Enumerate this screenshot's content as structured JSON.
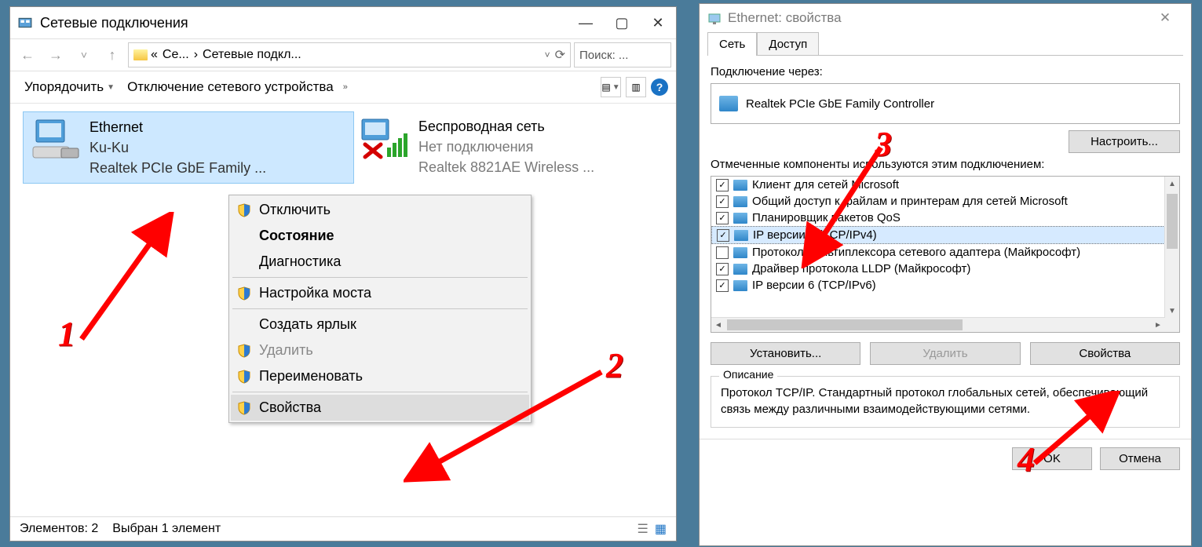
{
  "left_window": {
    "title": "Сетевые подключения",
    "breadcrumb_short": "Се...",
    "breadcrumb_long": "Сетевые подкл...",
    "search_placeholder": "Поиск: ...",
    "toolbar": {
      "sort": "Упорядочить",
      "disable": "Отключение сетевого устройства"
    },
    "connections": [
      {
        "name": "Ethernet",
        "status": "Ku-Ku",
        "device": "Realtek PCIe GbE Family ...",
        "selected": true,
        "fault": false
      },
      {
        "name": "Беспроводная сеть",
        "status": "Нет подключения",
        "device": "Realtek 8821AE Wireless ...",
        "selected": false,
        "fault": true
      }
    ],
    "statusbar": {
      "count": "Элементов: 2",
      "selected": "Выбран 1 элемент"
    },
    "context_menu": {
      "disconnect": "Отключить",
      "status": "Состояние",
      "diagnose": "Диагностика",
      "bridge": "Настройка моста",
      "shortcut": "Создать ярлык",
      "delete": "Удалить",
      "rename": "Переименовать",
      "properties": "Свойства"
    }
  },
  "right_window": {
    "title": "Ethernet: свойства",
    "tab_net": "Сеть",
    "tab_access": "Доступ",
    "connect_via_label": "Подключение через:",
    "adapter": "Realtek PCIe GbE Family Controller",
    "configure_btn": "Настроить...",
    "components_label": "Отмеченные компоненты используются этим подключением:",
    "components": [
      {
        "checked": true,
        "label": "Клиент для сетей Microsoft"
      },
      {
        "checked": true,
        "label": "Общий доступ к файлам и принтерам для сетей Microsoft"
      },
      {
        "checked": true,
        "label": "Планировщик пакетов QoS"
      },
      {
        "checked": true,
        "label": "IP версии 4 (TCP/IPv4)",
        "selected": true
      },
      {
        "checked": false,
        "label": "Протокол мультиплексора сетевого адаптера (Майкрософт)"
      },
      {
        "checked": true,
        "label": "Драйвер протокола LLDP (Майкрософт)"
      },
      {
        "checked": true,
        "label": "IP версии 6 (TCP/IPv6)"
      }
    ],
    "install_btn": "Установить...",
    "remove_btn": "Удалить",
    "props_btn": "Свойства",
    "description_label": "Описание",
    "description_text": "Протокол TCP/IP. Стандартный протокол глобальных сетей, обеспечивающий связь между различными взаимодействующими сетями.",
    "ok_btn": "OK",
    "cancel_btn": "Отмена"
  },
  "annotations": {
    "n1": "1",
    "n2": "2",
    "n3": "3",
    "n4": "4"
  }
}
